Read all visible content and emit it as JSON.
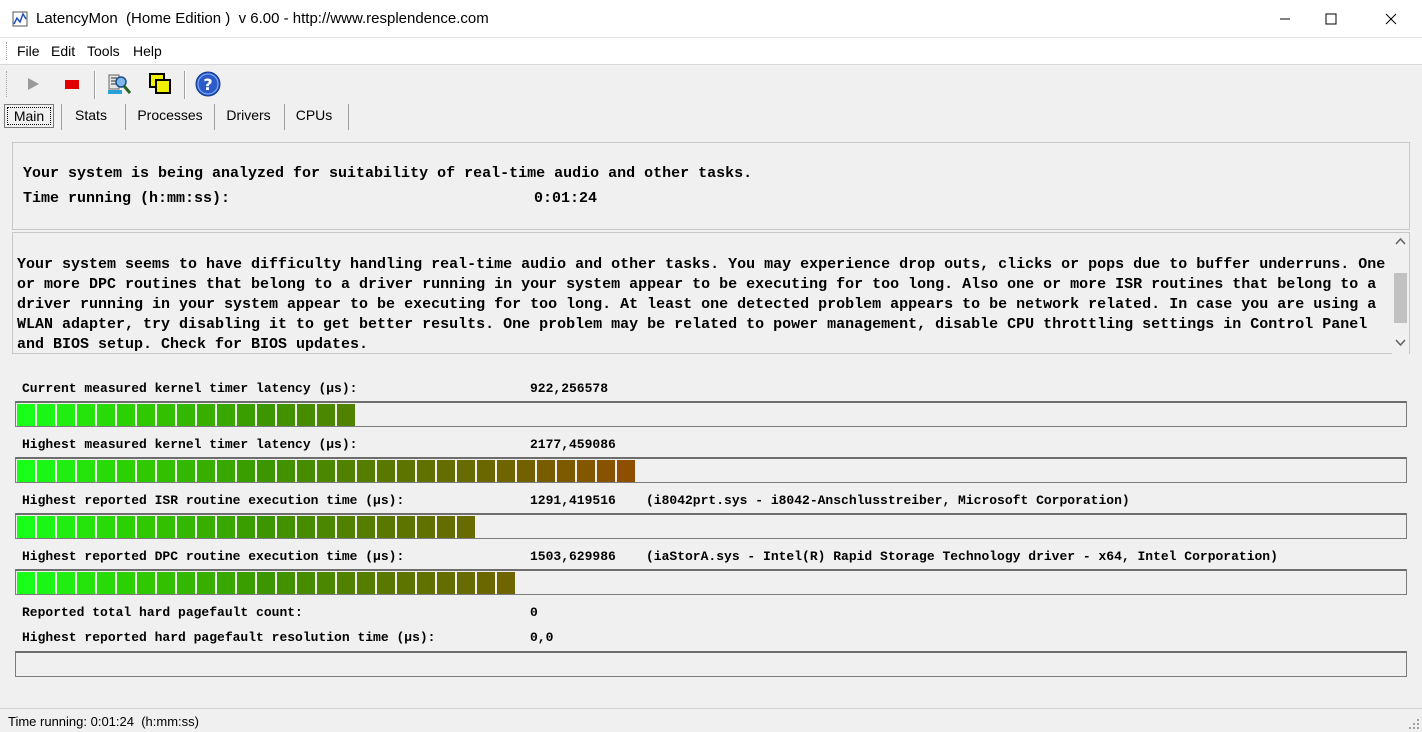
{
  "window": {
    "title": "LatencyMon  (Home Edition )  v 6.00 - http://www.resplendence.com"
  },
  "menu": [
    "File",
    "Edit",
    "Tools",
    "Help"
  ],
  "toolbar": {
    "icons": [
      "play-icon",
      "stop-icon",
      "inspect-icon",
      "windows-icon",
      "help-icon"
    ]
  },
  "tabs": [
    {
      "label": "Main",
      "active": true
    },
    {
      "label": "Stats",
      "active": false
    },
    {
      "label": "Processes",
      "active": false
    },
    {
      "label": "Drivers",
      "active": false
    },
    {
      "label": "CPUs",
      "active": false
    }
  ],
  "analysis": {
    "status_line": "Your system is being analyzed for suitability of real-time audio and other tasks.",
    "time_label": "Time running (h:mm:ss):",
    "time_value": "0:01:24"
  },
  "conclusion": "Your system seems to have difficulty handling real-time audio and other tasks. You may experience drop outs, clicks or pops due to buffer underruns. One or more DPC routines that belong to a driver running in your system appear to be executing for too long. Also one or more ISR routines that belong to a driver running in your system appear to be executing for too long. At least one detected problem appears to be network related. In case you are using a WLAN adapter, try disabling it to get better results. One problem may be related to power management, disable CPU throttling settings in Control Panel and BIOS setup. Check for BIOS updates.",
  "metrics": [
    {
      "label": "Current measured kernel timer latency (µs):",
      "value": "922,256578",
      "detail": "",
      "level_percent": 25.8
    },
    {
      "label": "Highest measured kernel timer latency (µs):",
      "value": "2177,459086",
      "detail": "",
      "level_percent": 45.9
    },
    {
      "label": "Highest reported ISR routine execution time (µs):",
      "value": "1291,419516",
      "detail": "(i8042prt.sys - i8042-Anschlusstreiber, Microsoft Corporation)",
      "level_percent": 34.4
    },
    {
      "label": "Highest reported DPC routine execution time (µs):",
      "value": "1503,629986",
      "detail": "(iaStorA.sys - Intel(R) Rapid Storage Technology driver - x64, Intel Corporation)",
      "level_percent": 37.3
    }
  ],
  "pagefault": {
    "count_label": "Reported total hard pagefault count:",
    "count_value": "0",
    "time_label": "Highest reported hard pagefault resolution time (µs):",
    "time_value": "0,0",
    "level_percent": 0
  },
  "status": "Time running: 0:01:24  (h:mm:ss)"
}
